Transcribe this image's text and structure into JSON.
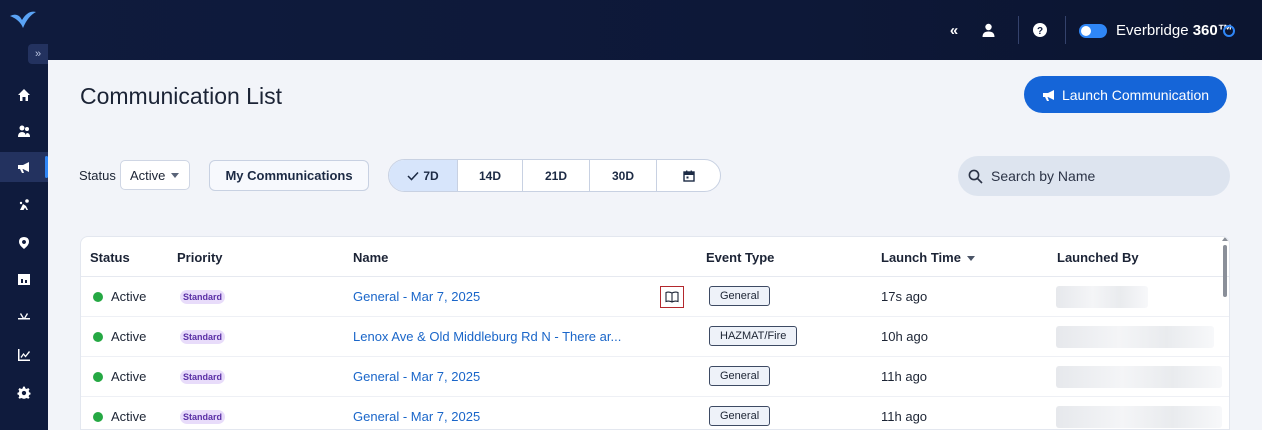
{
  "topbar": {
    "collapse_icon": "double-chevron-left-icon",
    "user_icon": "user-icon",
    "help_icon": "help-icon",
    "brand_name": "Everbridge",
    "brand_suffix": "360™",
    "brand_info_icon": "info-circle-icon"
  },
  "sidebar": {
    "expand_label": "»",
    "items": [
      {
        "icon": "home-icon"
      },
      {
        "icon": "people-icon"
      },
      {
        "icon": "megaphone-icon"
      },
      {
        "icon": "incident-icon"
      },
      {
        "icon": "location-pin-icon"
      },
      {
        "icon": "calendar-icon"
      },
      {
        "icon": "crossroad-icon"
      },
      {
        "icon": "chart-icon"
      },
      {
        "icon": "gear-icon"
      }
    ]
  },
  "page": {
    "title": "Communication List",
    "launch_label": "Launch Communication"
  },
  "filters": {
    "status_label": "Status",
    "status_value": "Active",
    "my_comm_label": "My Communications",
    "days": [
      "7D",
      "14D",
      "21D",
      "30D"
    ],
    "selected_day": "7D",
    "search_placeholder": "Search by Name"
  },
  "table": {
    "columns": [
      "Status",
      "Priority",
      "Name",
      "Event Type",
      "Launch Time",
      "Launched By"
    ],
    "rows": [
      {
        "status": "Active",
        "priority": "Standard",
        "name": "General - Mar 7, 2025",
        "event_type": "General",
        "launch_time": "17s ago"
      },
      {
        "status": "Active",
        "priority": "Standard",
        "name": "Lenox Ave & Old Middleburg Rd N - There ar...",
        "event_type": "HAZMAT/Fire",
        "launch_time": "10h ago"
      },
      {
        "status": "Active",
        "priority": "Standard",
        "name": "General - Mar 7, 2025",
        "event_type": "General",
        "launch_time": "11h ago"
      },
      {
        "status": "Active",
        "priority": "Standard",
        "name": "General - Mar 7, 2025",
        "event_type": "General",
        "launch_time": "11h ago"
      }
    ]
  },
  "colors": {
    "nav_bg": "#0f1b3d",
    "accent": "#1565d8",
    "active_dot": "#25a843",
    "link": "#1a66c9",
    "priority_bg": "#e8dcfa"
  }
}
